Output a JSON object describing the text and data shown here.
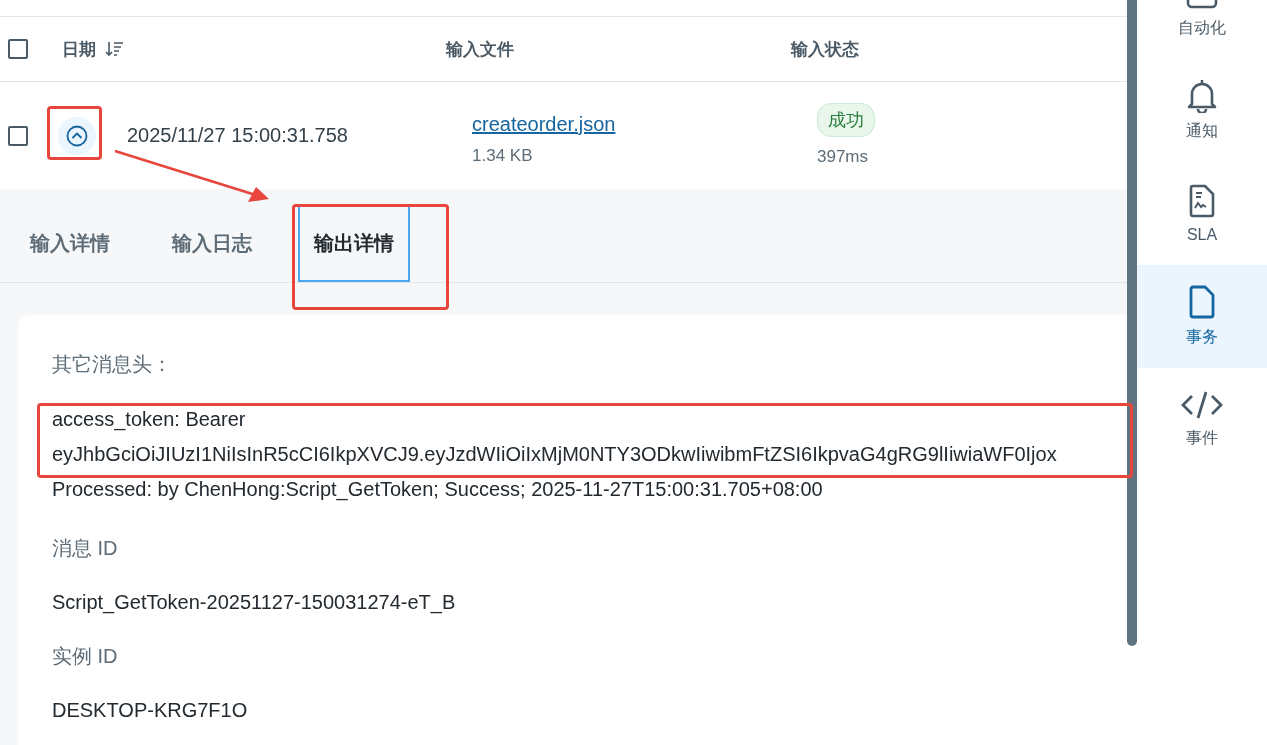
{
  "table": {
    "select_all": {
      "checked": false
    },
    "columns": [
      {
        "label": "日期",
        "sorted": true
      },
      {
        "label": "输入文件",
        "sorted": false
      },
      {
        "label": "输入状态",
        "sorted": false
      }
    ],
    "rows": [
      {
        "checked": false,
        "expanded": true,
        "date": "2025/11/27 15:00:31.758",
        "file": "createorder.json",
        "size": "1.34 KB",
        "status": "成功",
        "kind": "success",
        "duration": "397ms"
      }
    ]
  },
  "detail": {
    "tabs": [
      {
        "label": "输入详情",
        "selected": false
      },
      {
        "label": "输入日志",
        "selected": false
      },
      {
        "label": "输出详情",
        "selected": true
      }
    ],
    "fields": [
      {
        "kind": "headers",
        "label": "其它消息头：",
        "lines": [
          "access_token: Bearer",
          "eyJhbGciOiJIUzI1NiIsInR5cCI6IkpXVCJ9.eyJzdWIiOiIxMjM0NTY3ODkwIiwibmFtZSI6IkpvaG4gRG9lIiwiaWF0Ijox",
          "Processed: by ChenHong:Script_GetToken; Success; 2025-11-27T15:00:31.705+08:00"
        ]
      },
      {
        "kind": "field",
        "label": "消息 ID",
        "value": "Script_GetToken-20251127-150031274-eT_B"
      },
      {
        "kind": "field",
        "label": "实例 ID",
        "value": "DESKTOP-KRG7F1O"
      }
    ]
  },
  "sidebar": {
    "items": [
      {
        "label": "自动化",
        "kind": "automation",
        "selected": false
      },
      {
        "label": "通知",
        "kind": "bell",
        "selected": false
      },
      {
        "label": "SLA",
        "kind": "sla",
        "selected": false
      },
      {
        "label": "事务",
        "kind": "document",
        "selected": true
      },
      {
        "label": "事件",
        "kind": "code",
        "selected": false
      }
    ]
  }
}
